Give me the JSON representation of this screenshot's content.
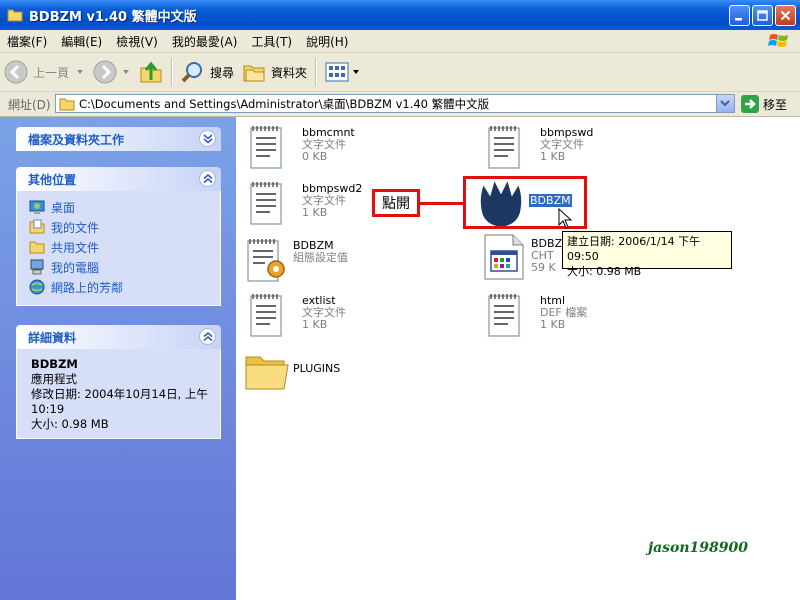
{
  "window": {
    "title": "BDBZM v1.40 繁體中文版"
  },
  "menu": [
    "檔案(F)",
    "編輯(E)",
    "檢視(V)",
    "我的最愛(A)",
    "工具(T)",
    "說明(H)"
  ],
  "toolbar": {
    "back": "上一頁",
    "search": "搜尋",
    "folders": "資料夾"
  },
  "address": {
    "label": "網址(D)",
    "path": "C:\\Documents and Settings\\Administrator\\桌面\\BDBZM v1.40 繁體中文版",
    "go": "移至"
  },
  "tasks": {
    "file_tasks": "檔案及資料夾工作",
    "other_places": {
      "title": "其他位置",
      "items": [
        "桌面",
        "我的文件",
        "共用文件",
        "我的電腦",
        "網路上的芳鄰"
      ]
    },
    "details": {
      "title": "詳細資料",
      "name": "BDBZM",
      "type": "應用程式",
      "modified_line1": "修改日期: 2004年10月14日, 上午",
      "modified_line2": "10:19",
      "size": "大小: 0.98 MB"
    }
  },
  "files": [
    {
      "name": "bbmcmnt",
      "type": "文字文件",
      "size": "0 KB",
      "icon": "text-file-icon"
    },
    {
      "name": "bbmpswd",
      "type": "文字文件",
      "size": "1 KB",
      "icon": "text-file-icon"
    },
    {
      "name": "bbmpswd2",
      "type": "文字文件",
      "size": "1 KB",
      "icon": "text-file-icon"
    },
    {
      "name": "BDBZM",
      "type": "",
      "size": "",
      "icon": "app-crown-icon"
    },
    {
      "name": "BDBZM",
      "type": "組態設定值",
      "size": "",
      "icon": "config-file-icon"
    },
    {
      "name": "BDBZ",
      "type": "CHT",
      "size": "59 K",
      "icon": "cht-file-icon"
    },
    {
      "name": "extlist",
      "type": "文字文件",
      "size": "1 KB",
      "icon": "text-file-icon"
    },
    {
      "name": "html",
      "type": "DEF 檔案",
      "size": "1 KB",
      "icon": "text-file-icon"
    },
    {
      "name": "PLUGINS",
      "type": "",
      "size": "",
      "icon": "folder-icon"
    }
  ],
  "annotation": {
    "callout": "點開"
  },
  "tooltip": {
    "line1": "建立日期: 2006/1/14 下午 09:50",
    "line2": "大小: 0.98 MB"
  },
  "watermark": "jason198900",
  "colors": {
    "titlebar": "#0a5fd8",
    "taskpane": "#6f8edf",
    "accent_red": "#e0100c",
    "link": "#215dc6"
  }
}
